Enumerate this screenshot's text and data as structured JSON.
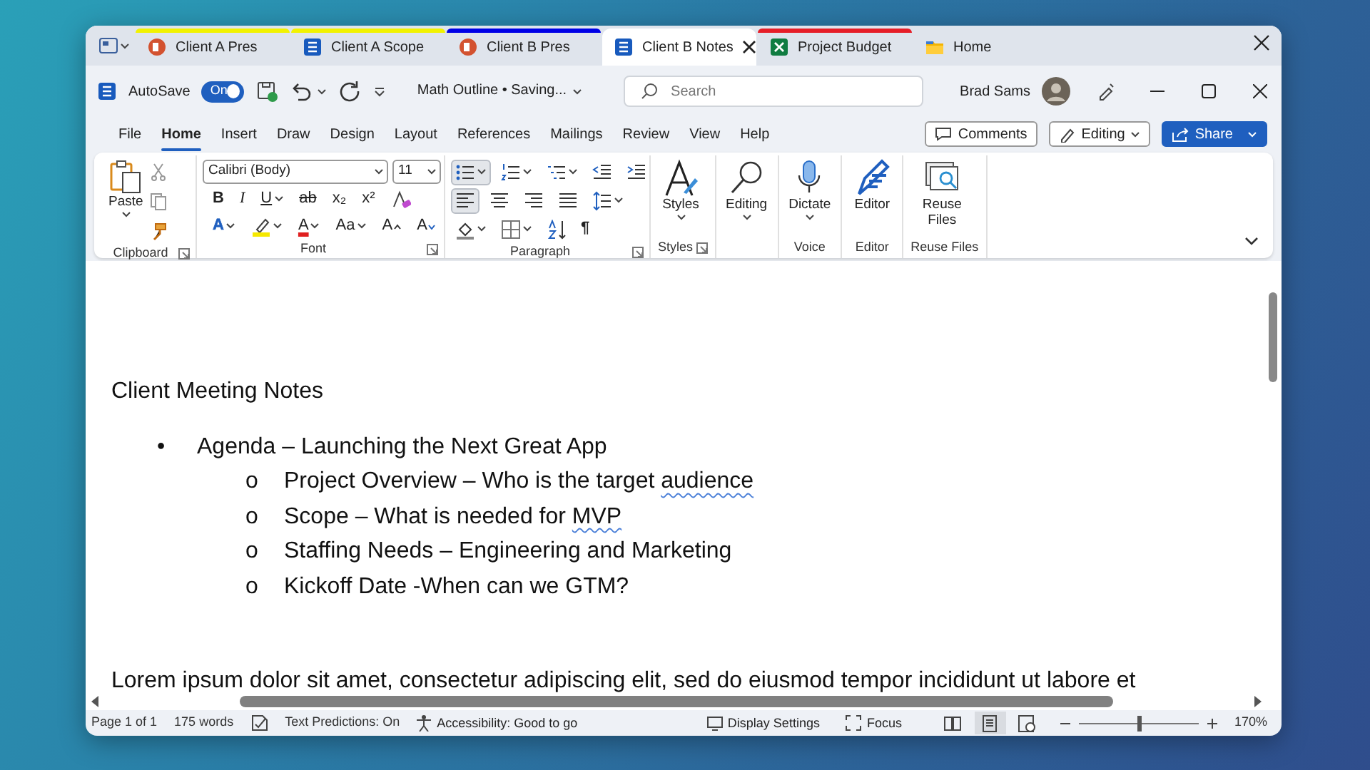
{
  "tabs": [
    {
      "label": "Client A Pres",
      "kind": "powerpoint",
      "color": "#f2f200",
      "selected": false
    },
    {
      "label": "Client A Scope",
      "kind": "word",
      "color": "#f2f200",
      "selected": false
    },
    {
      "label": "Client B Pres",
      "kind": "powerpoint",
      "color": "#0000e6",
      "selected": false
    },
    {
      "label": "Client B Notes",
      "kind": "word",
      "selected": true
    },
    {
      "label": "Project Budget",
      "kind": "excel",
      "color": "#e61e28",
      "selected": false
    },
    {
      "label": "Home",
      "kind": "folder",
      "selected": false
    }
  ],
  "title_bar": {
    "autosave_label": "AutoSave",
    "autosave": {
      "on": true,
      "text": "On"
    },
    "document_title": "Math Outline • Saving...",
    "search": {
      "placeholder": "Search"
    },
    "user": "Brad Sams"
  },
  "menu": [
    {
      "label": "File",
      "selected": false
    },
    {
      "label": "Home",
      "selected": true
    },
    {
      "label": "Insert",
      "selected": false
    },
    {
      "label": "Draw",
      "selected": false
    },
    {
      "label": "Design",
      "selected": false
    },
    {
      "label": "Layout",
      "selected": false
    },
    {
      "label": "References",
      "selected": false
    },
    {
      "label": "Mailings",
      "selected": false
    },
    {
      "label": "Review",
      "selected": false
    },
    {
      "label": "View",
      "selected": false
    },
    {
      "label": "Help",
      "selected": false
    }
  ],
  "actions": [
    {
      "kind": "comments",
      "label": "Comments"
    },
    {
      "kind": "editing",
      "label": "Editing"
    },
    {
      "kind": "share",
      "label": "Share"
    }
  ],
  "ribbon": [
    {
      "kind": "clipboard",
      "label": "Clipboard",
      "launcher": true,
      "button": "Paste"
    },
    {
      "kind": "font",
      "label": "Font",
      "launcher": true,
      "font_name": "Calibri (Body)",
      "font_size": "11",
      "buttons": [
        {
          "kind": "bold",
          "glyph": "B"
        },
        {
          "kind": "italic",
          "glyph": "I"
        },
        {
          "kind": "underline",
          "glyph": "U"
        },
        {
          "kind": "strike",
          "glyph": "ab"
        },
        {
          "kind": "subscript",
          "glyph": "x₂"
        },
        {
          "kind": "superscript",
          "glyph": "x²"
        },
        {
          "kind": "clear"
        },
        {
          "kind": "effects",
          "glyph": "A"
        },
        {
          "kind": "highlight"
        },
        {
          "kind": "color",
          "glyph": "A"
        },
        {
          "kind": "case",
          "glyph": "Aa"
        },
        {
          "kind": "grow",
          "glyph": "A"
        },
        {
          "kind": "shrink",
          "glyph": "A"
        }
      ]
    },
    {
      "kind": "paragraph",
      "label": "Paragraph",
      "launcher": true,
      "buttons": [
        {
          "kind": "bullets",
          "selected": true
        },
        {
          "kind": "numbering",
          "selected": false
        },
        {
          "kind": "multilevel",
          "selected": false
        },
        {
          "kind": "outdent",
          "selected": false
        },
        {
          "kind": "indent",
          "selected": false
        },
        {
          "kind": "align-left",
          "selected": true
        },
        {
          "kind": "align-center",
          "selected": false
        },
        {
          "kind": "align-right",
          "selected": false
        },
        {
          "kind": "justify",
          "selected": false
        },
        {
          "kind": "line-spacing",
          "selected": false
        },
        {
          "kind": "shading",
          "selected": false
        },
        {
          "kind": "borders",
          "selected": false
        },
        {
          "kind": "sort",
          "selected": false
        },
        {
          "kind": "marks",
          "glyph": "¶",
          "selected": false
        }
      ]
    },
    {
      "kind": "styles",
      "label": "Styles",
      "launcher": true,
      "button": "Styles",
      "dropdown": true
    },
    {
      "kind": "find",
      "button": "Editing",
      "dropdown": true
    },
    {
      "kind": "dictate",
      "label": "Voice",
      "button": "Dictate",
      "dropdown": true
    },
    {
      "kind": "editor",
      "label": "Editor",
      "button": "Editor",
      "dropdown": false
    },
    {
      "kind": "reuse",
      "label": "Reuse Files",
      "button": "Reuse Files",
      "dropdown": false
    }
  ],
  "document": {
    "title": "Client Meeting Notes",
    "items": [
      {
        "marker": "•",
        "runs": [
          {
            "text": "Agenda – Launching the Next Great App",
            "flagged": false
          }
        ],
        "children": [
          {
            "marker": "o",
            "runs": [
              {
                "text": "Project Overview – Who is the target ",
                "flagged": false
              },
              {
                "text": "audience",
                "flagged": true
              }
            ]
          },
          {
            "marker": "o",
            "runs": [
              {
                "text": "Scope – What is needed for ",
                "flagged": false
              },
              {
                "text": "MVP",
                "flagged": true
              }
            ]
          },
          {
            "marker": "o",
            "runs": [
              {
                "text": "Staffing Needs – Engineering and Marketing",
                "flagged": false
              }
            ]
          },
          {
            "marker": "o",
            "runs": [
              {
                "text": "Kickoff Date -When can we GTM?",
                "flagged": false
              }
            ]
          }
        ]
      }
    ],
    "paragraph": "Lorem ipsum dolor sit amet, consectetur adipiscing elit, sed do eiusmod tempor incididunt ut labore et"
  },
  "status_bar": {
    "page": "Page 1 of 1",
    "words": "175 words",
    "text_predictions": "Text Predictions: On",
    "accessibility": "Accessibility: Good to go",
    "display_settings": "Display Settings",
    "focus": "Focus",
    "views": [
      {
        "kind": "read",
        "selected": false
      },
      {
        "kind": "print",
        "selected": true
      },
      {
        "kind": "web",
        "selected": false
      }
    ],
    "zoom": {
      "level": 0.5,
      "reading": "170%"
    }
  }
}
